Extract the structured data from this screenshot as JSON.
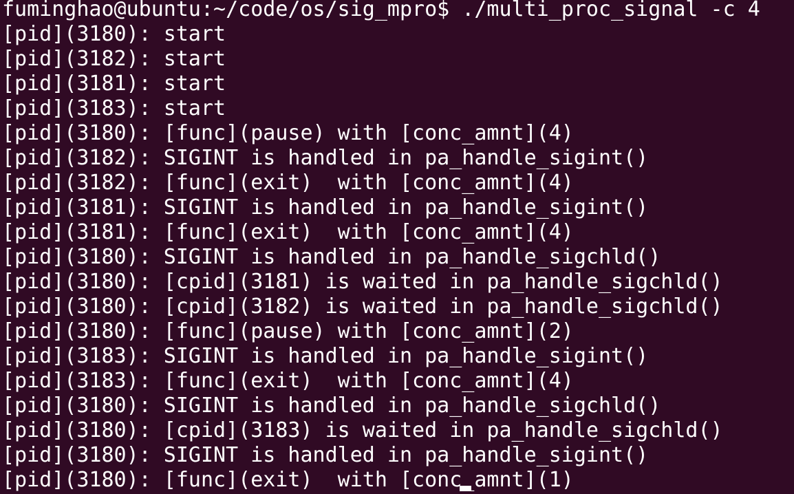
{
  "terminal": {
    "prompt": "fuminghao@ubuntu:~/code/os/sig_mpro$",
    "command": " ./multi_proc_signal -c 4",
    "output_lines": [
      "[pid](3180): start",
      "[pid](3182): start",
      "[pid](3181): start",
      "[pid](3183): start",
      "[pid](3180): [func](pause) with [conc_amnt](4)",
      "[pid](3182): SIGINT is handled in pa_handle_sigint()",
      "[pid](3182): [func](exit)  with [conc_amnt](4)",
      "[pid](3181): SIGINT is handled in pa_handle_sigint()",
      "[pid](3181): [func](exit)  with [conc_amnt](4)",
      "[pid](3180): SIGINT is handled in pa_handle_sigchld()",
      "[pid](3180): [cpid](3181) is waited in pa_handle_sigchld()",
      "[pid](3180): [cpid](3182) is waited in pa_handle_sigchld()",
      "[pid](3180): [func](pause) with [conc_amnt](2)",
      "[pid](3183): SIGINT is handled in pa_handle_sigint()",
      "[pid](3183): [func](exit)  with [conc_amnt](4)",
      "[pid](3180): SIGINT is handled in pa_handle_sigchld()",
      "[pid](3180): [cpid](3183) is waited in pa_handle_sigchld()",
      "[pid](3180): SIGINT is handled in pa_handle_sigint()",
      "[pid](3180): [func](exit)  with [conc_amnt](1)"
    ],
    "colors": {
      "background": "#300a24",
      "foreground": "#ffffff"
    }
  }
}
